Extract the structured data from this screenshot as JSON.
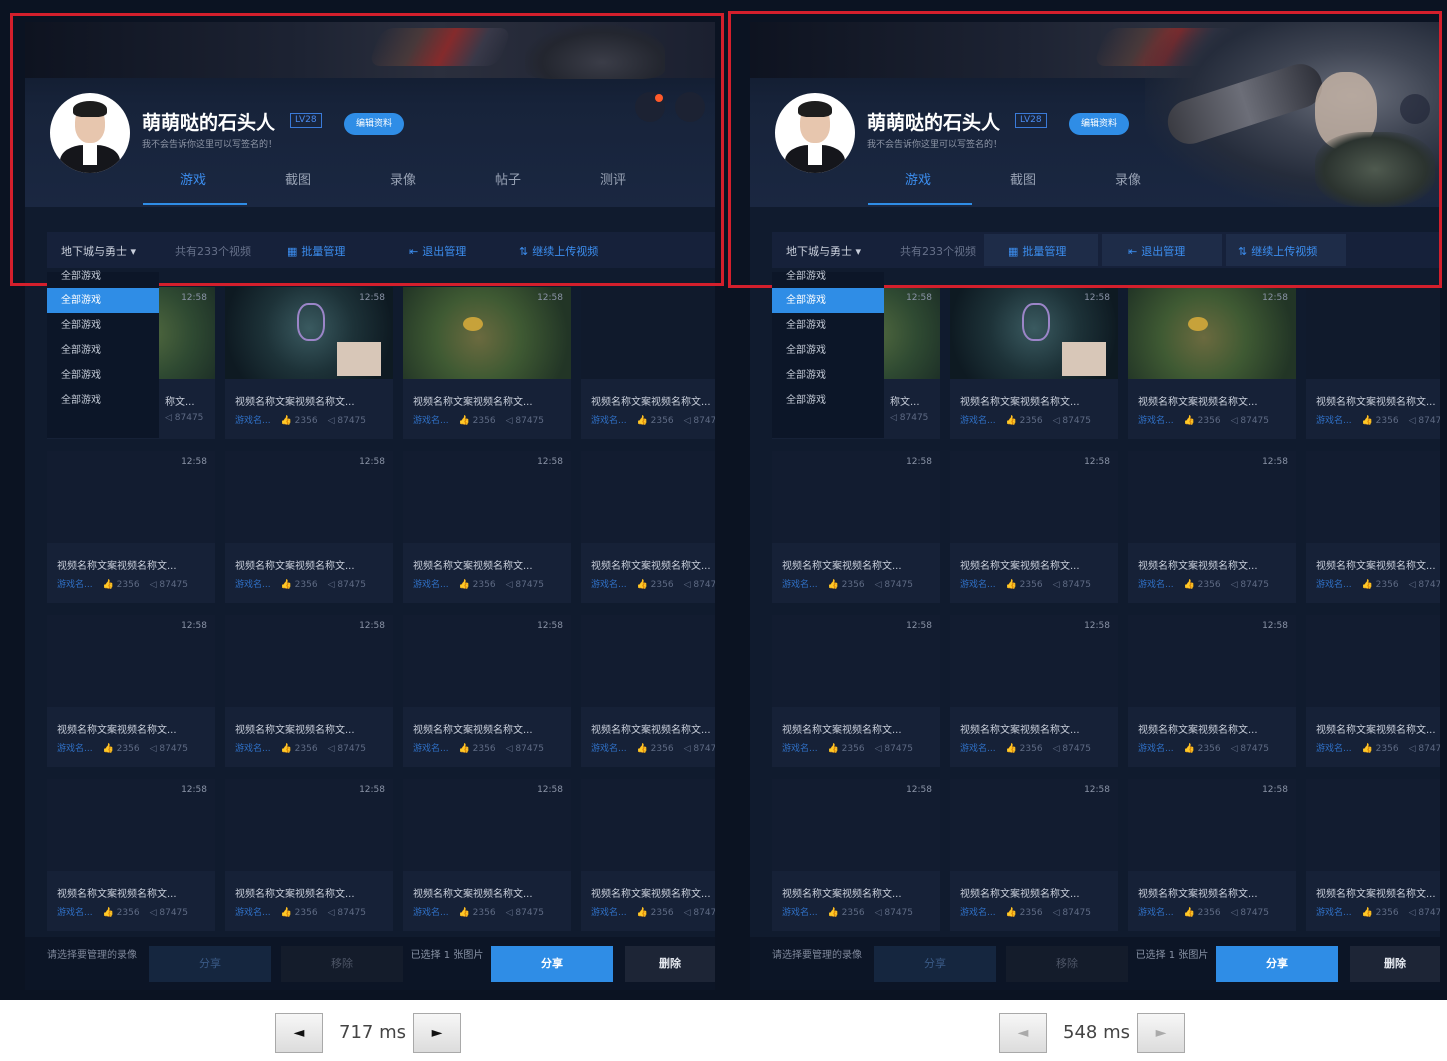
{
  "profile": {
    "username": "萌萌哒的石头人",
    "level": "LV28",
    "edit_label": "编辑资料",
    "signature": "我不会告诉你这里可以写签名的！"
  },
  "tabs": [
    "游戏",
    "截图",
    "录像",
    "帖子",
    "测评"
  ],
  "toolbar": {
    "filter": "地下城与勇士 ▾",
    "count": "共有233个视频",
    "batch": "批量管理",
    "exit": "退出管理",
    "upload": "继续上传视频"
  },
  "dropdown": [
    "全部游戏",
    "全部游戏",
    "全部游戏",
    "全部游戏",
    "全部游戏",
    "全部游戏"
  ],
  "card": {
    "duration": "12:58",
    "title": "视频名称文案视频名称文...",
    "title_cut": "称文...",
    "category": "游戏名...",
    "likes": "👍 2356",
    "views": "◁ 87475"
  },
  "footer": {
    "hint": "请选择要管理的录像",
    "share_dim": "分享",
    "remove_dim": "移除",
    "selected": "已选择 1 张图片",
    "share": "分享",
    "delete": "删除"
  },
  "timers": {
    "left": "717 ms",
    "right": "548 ms",
    "prev": "◄",
    "next": "►"
  },
  "colors": {
    "accent": "#2f8de6",
    "highlight_box": "#d41f2c",
    "panel_bg": "#101b2e"
  }
}
